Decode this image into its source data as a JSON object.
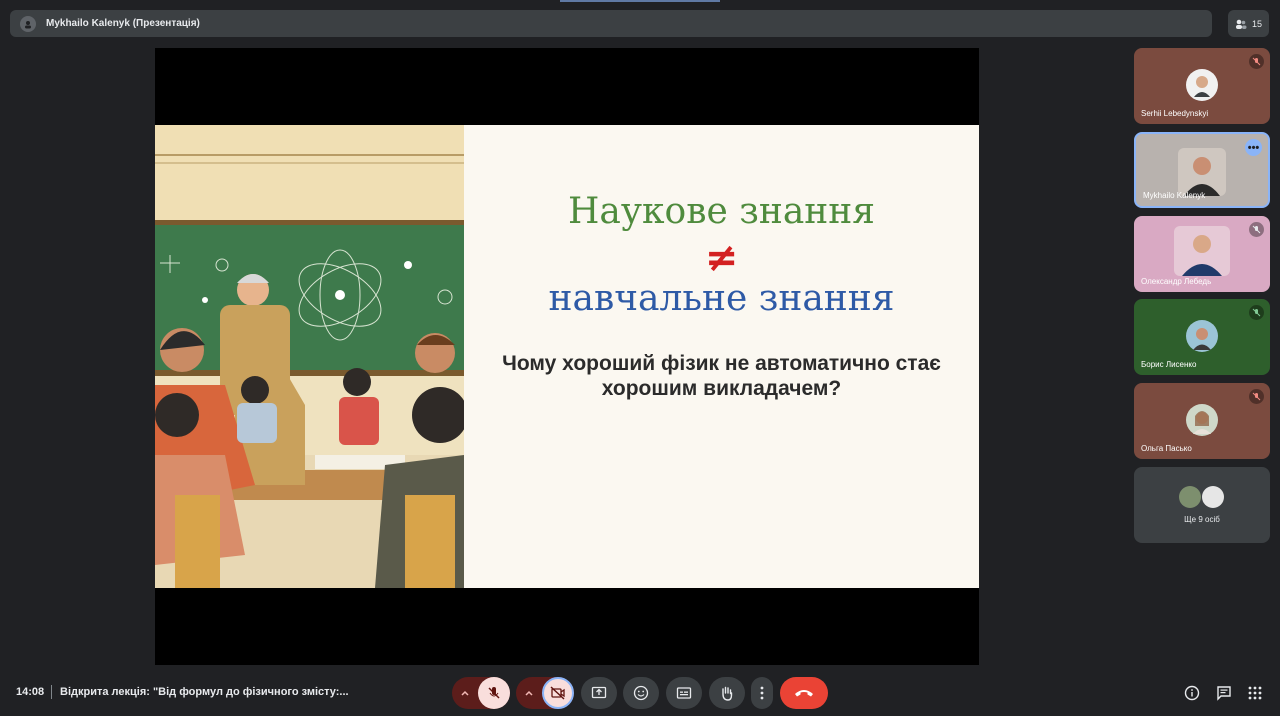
{
  "window": {
    "presenter_title": "Mykhailo Kalenyk (Презентація)",
    "participant_count": "15"
  },
  "slide": {
    "title_line1": "Наукове знання",
    "not_equal": "≠",
    "title_line2": "навчальне знання",
    "question": "Чому хороший фізик не автоматично стає хорошим викладачем?",
    "colors": {
      "green": "#4f8b3d",
      "red": "#d32121",
      "blue": "#2e5aa6"
    }
  },
  "participants": [
    {
      "name": "Serhii Lebedynskyi",
      "muted": true,
      "bg": "#7b4b3f"
    },
    {
      "name": "Mykhailo Kalenyk",
      "muted": false,
      "bg": "#c9c4c2",
      "active": true
    },
    {
      "name": "Олександр Лебедь",
      "muted": true,
      "bg": "#d9a9c3"
    },
    {
      "name": "Борис Лисенко",
      "muted": true,
      "bg": "#2e5f2c"
    },
    {
      "name": "Ольга Пасько",
      "muted": true,
      "bg": "#7b4b3f"
    }
  ],
  "others": {
    "label": "Ще 9 осіб"
  },
  "bottom": {
    "time": "14:08",
    "meeting_title": "Відкрита лекція: \"Від формул до фізичного змісту:..."
  }
}
